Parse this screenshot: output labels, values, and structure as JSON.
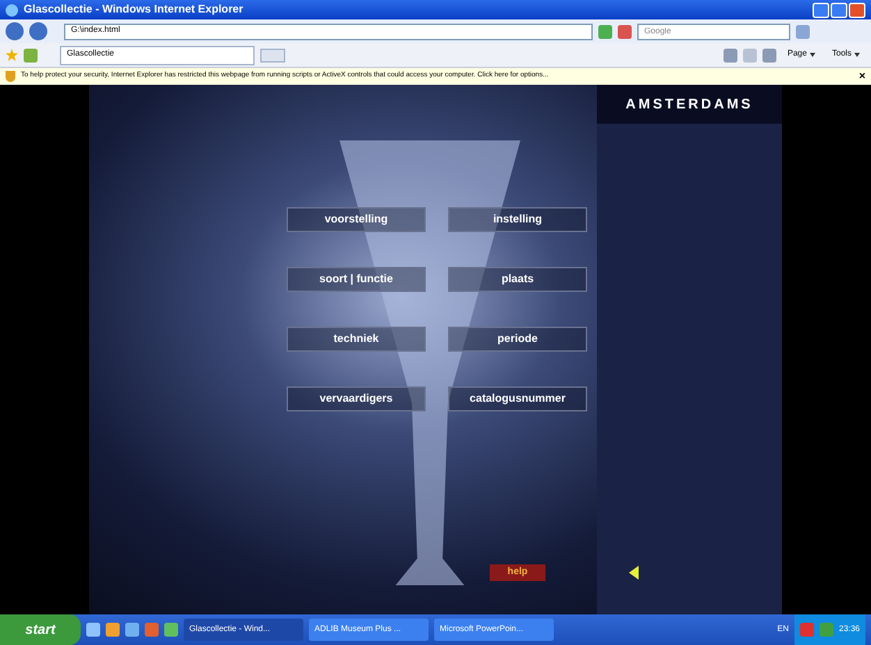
{
  "window": {
    "title": "Glascollectie - Windows Internet Explorer"
  },
  "address_bar": {
    "value": "G:\\index.html"
  },
  "search": {
    "placeholder": "Google"
  },
  "tabs": [
    {
      "label": "Glascollectie",
      "selected": true
    }
  ],
  "command_bar": [
    "Page",
    "Tools"
  ],
  "info_bar": {
    "text": "To help protect your security, Internet Explorer has restricted this webpage from running scripts or ActiveX controls that could access your computer. Click here for options...",
    "close": "×"
  },
  "page": {
    "brand": "AMSTERDAMS",
    "menu": [
      [
        "voorstelling",
        "instelling"
      ],
      [
        "soort | functie",
        "plaats"
      ],
      [
        "techniek",
        "periode"
      ],
      [
        "vervaardigers",
        "catalogusnummer"
      ]
    ],
    "help": "help"
  },
  "taskbar": {
    "start": "start",
    "windows": [
      {
        "label": "Glascollectie - Wind...",
        "selected": true
      },
      {
        "label": "ADLIB Museum Plus ...",
        "selected": false
      },
      {
        "label": "Microsoft PowerPoin...",
        "selected": false
      }
    ],
    "language": "EN",
    "clock": "23:36"
  }
}
